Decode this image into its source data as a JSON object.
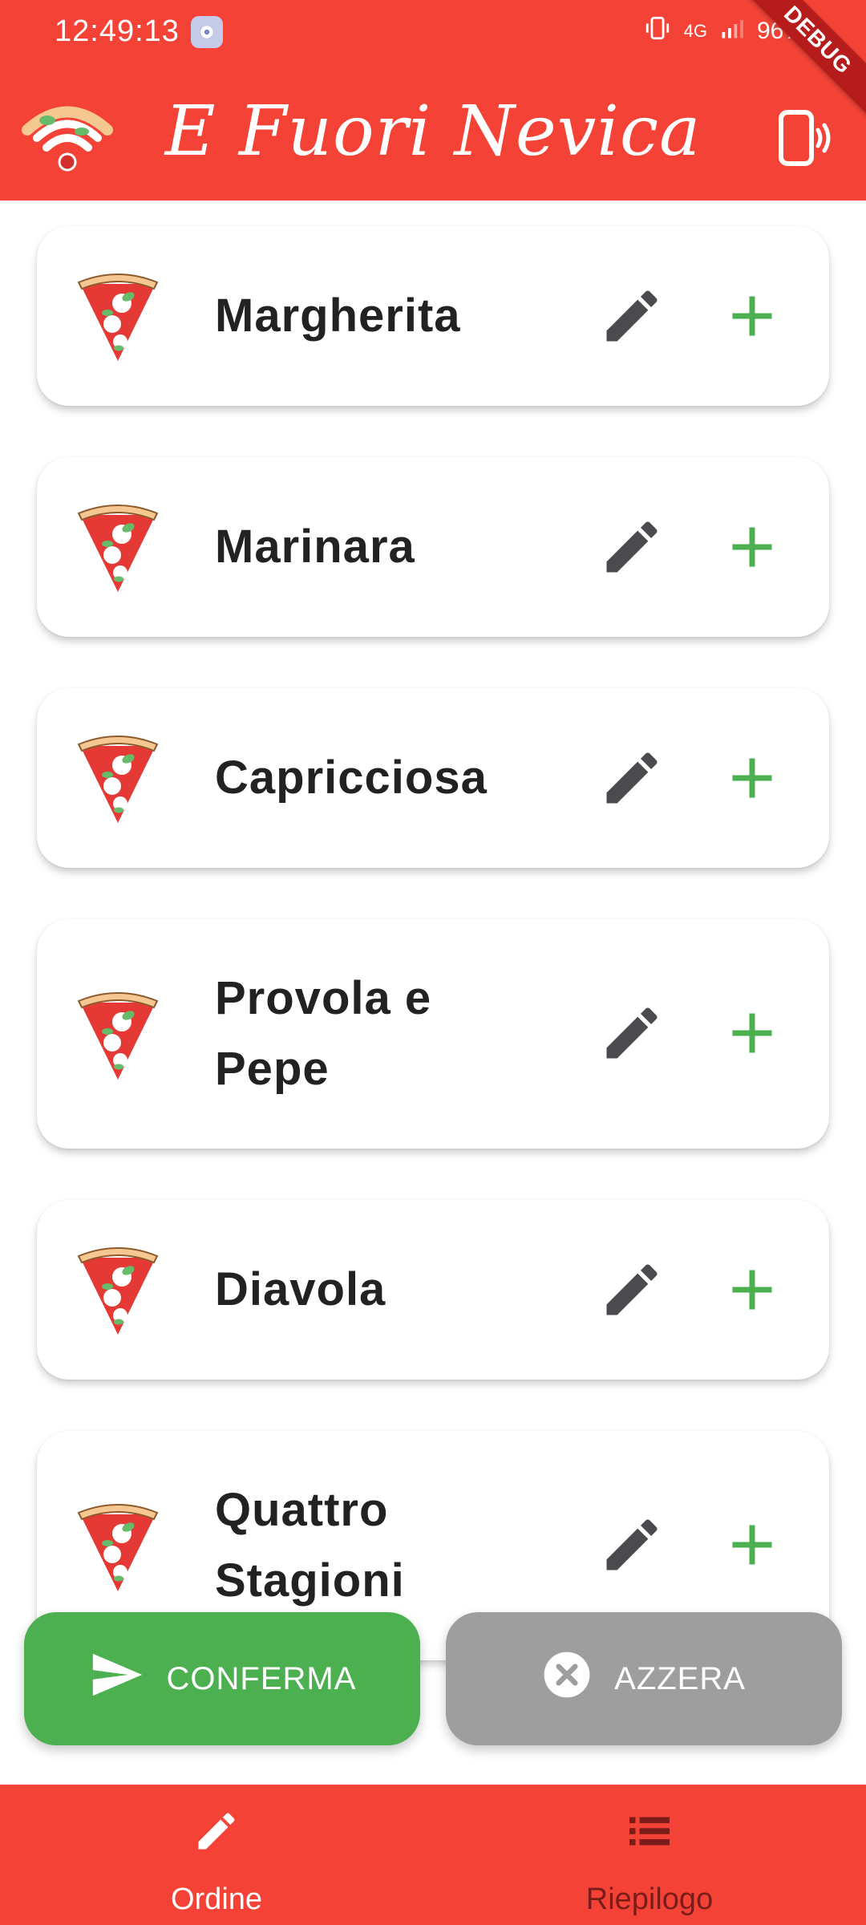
{
  "status": {
    "time": "12:49:13",
    "network": "4G",
    "battery": "96%",
    "debug": "DEBUG"
  },
  "appbar": {
    "title": "E Fuori Nevica",
    "logo_icon": "pizza-wifi-logo",
    "nfc_icon": "phone-nfc-icon"
  },
  "pizzas": [
    {
      "name": "Margherita"
    },
    {
      "name": "Marinara"
    },
    {
      "name": "Capricciosa"
    },
    {
      "name": "Provola e Pepe"
    },
    {
      "name": "Diavola"
    },
    {
      "name": "Quattro Stagioni"
    }
  ],
  "actions": {
    "confirm_label": "CONFERMA",
    "reset_label": "AZZERA"
  },
  "bottom_nav": {
    "items": [
      {
        "label": "Ordine",
        "icon": "pencil-icon",
        "active": true
      },
      {
        "label": "Riepilogo",
        "icon": "list-icon",
        "active": false
      }
    ]
  },
  "colors": {
    "primary": "#f44336",
    "add_green": "#4caf50",
    "edit_gray": "#4a4a4f",
    "reset_gray": "#9e9e9e"
  }
}
